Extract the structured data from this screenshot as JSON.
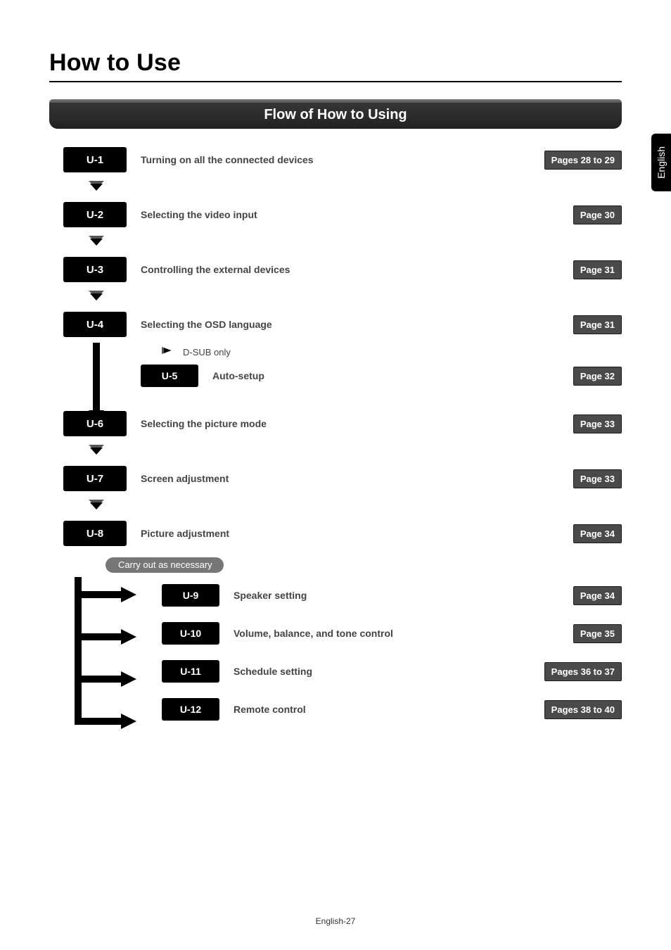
{
  "title": "How to Use",
  "banner": "Flow of How to Using",
  "side_tab": "English",
  "carry_out": "Carry out as necessary",
  "sub_note": "D-SUB only",
  "footer": "English-27",
  "steps": {
    "u1": {
      "code": "U-1",
      "title": "Turning on all the connected devices",
      "pages": "Pages 28 to 29"
    },
    "u2": {
      "code": "U-2",
      "title": "Selecting the video input",
      "pages": "Page 30"
    },
    "u3": {
      "code": "U-3",
      "title": "Controlling the external devices",
      "pages": "Page 31"
    },
    "u4": {
      "code": "U-4",
      "title": "Selecting the OSD language",
      "pages": "Page 31"
    },
    "u5": {
      "code": "U-5",
      "title": "Auto-setup",
      "pages": "Page 32"
    },
    "u6": {
      "code": "U-6",
      "title": "Selecting the picture mode",
      "pages": "Page 33"
    },
    "u7": {
      "code": "U-7",
      "title": "Screen adjustment",
      "pages": "Page 33"
    },
    "u8": {
      "code": "U-8",
      "title": "Picture adjustment",
      "pages": "Page 34"
    },
    "u9": {
      "code": "U-9",
      "title": "Speaker setting",
      "pages": "Page 34"
    },
    "u10": {
      "code": "U-10",
      "title": "Volume, balance, and tone control",
      "pages": "Page 35"
    },
    "u11": {
      "code": "U-11",
      "title": "Schedule setting",
      "pages": "Pages 36 to 37"
    },
    "u12": {
      "code": "U-12",
      "title": "Remote control",
      "pages": "Pages 38 to 40"
    }
  }
}
